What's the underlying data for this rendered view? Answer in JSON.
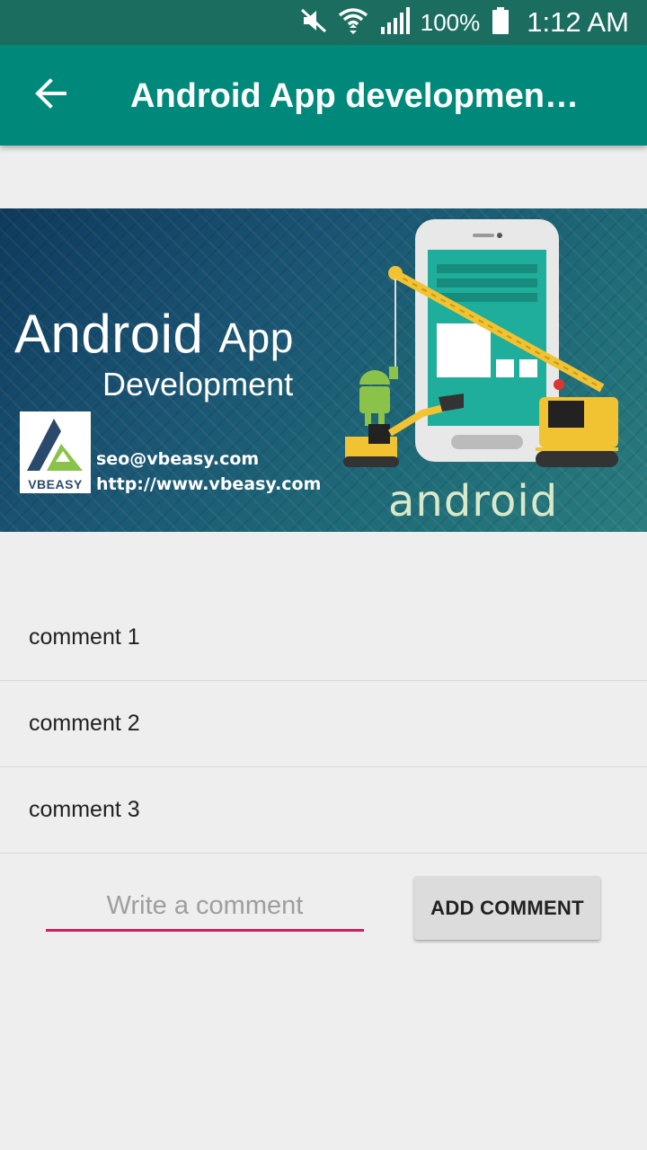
{
  "status_bar": {
    "battery_percent": "100%",
    "time": "1:12 AM",
    "icons": [
      "mute-icon",
      "wifi-icon",
      "signal-icon",
      "battery-icon"
    ]
  },
  "app_bar": {
    "back_icon": "arrow-back-icon",
    "title": "Android App development app",
    "background": "#00897b"
  },
  "banner": {
    "title_line1_word1": "Android",
    "title_line1_word2": "App",
    "title_line2": "Development",
    "logo_text": "VBEASY",
    "email": "seo@vbeasy.com",
    "url": "http://www.vbeasy.com",
    "android_wordmark": "android"
  },
  "comments": [
    {
      "text": "comment 1"
    },
    {
      "text": "comment 2"
    },
    {
      "text": "comment 3"
    }
  ],
  "comment_form": {
    "placeholder": "Write a comment",
    "value": "",
    "button_label": "ADD COMMENT",
    "underline_color": "#d81b60"
  }
}
